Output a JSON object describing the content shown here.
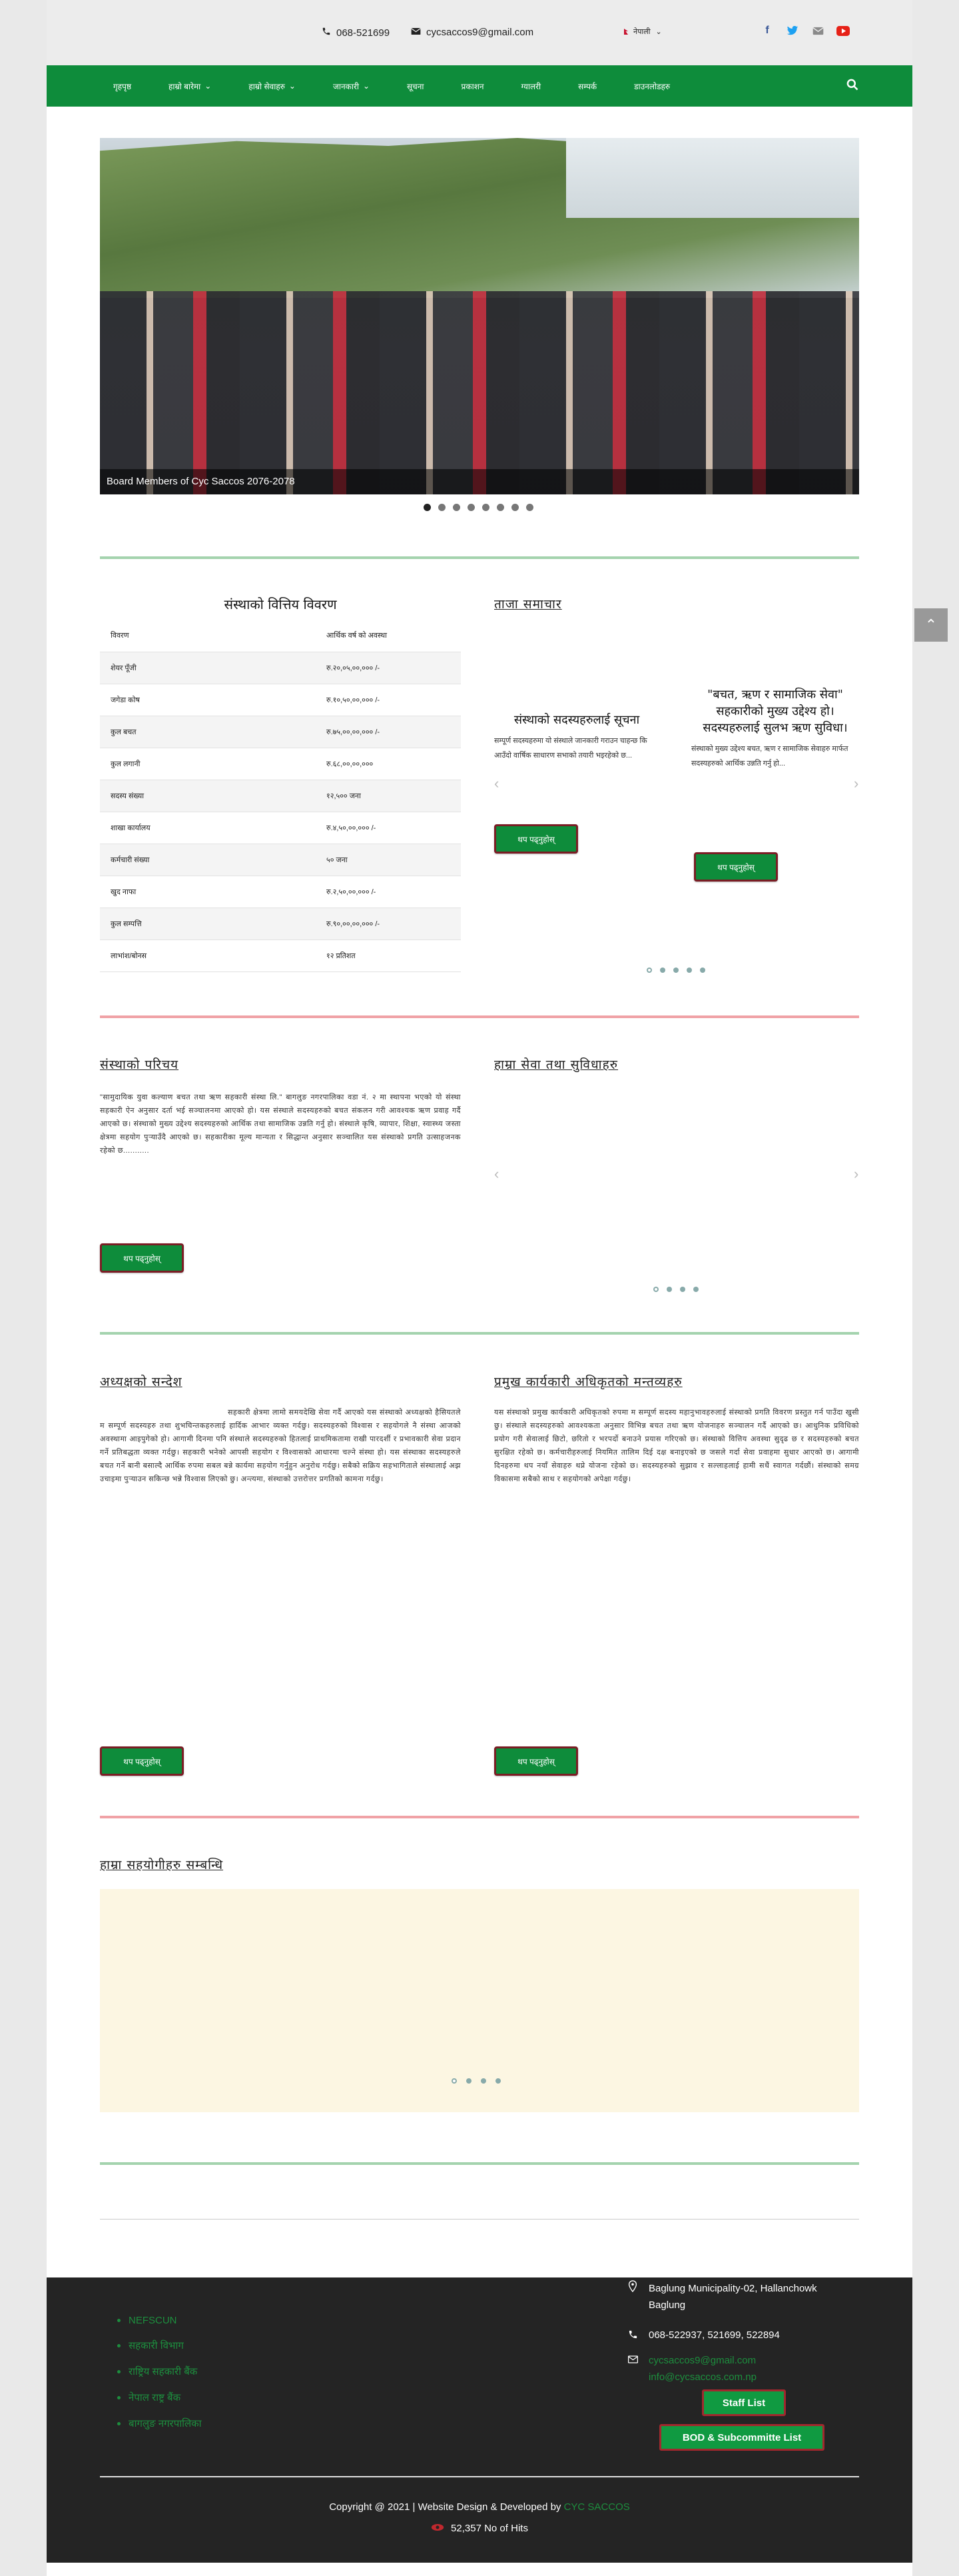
{
  "topbar": {
    "phone": "068-521699",
    "email": "cycsaccos9@gmail.com",
    "language": "नेपाली"
  },
  "nav": {
    "items": [
      "गृहपृष्ठ",
      "हाम्रो बारेमा",
      "हाम्रो सेवाहरु",
      "जानकारी",
      "सूचना",
      "प्रकाशन",
      "ग्यालरी",
      "सम्पर्क",
      "डाउनलोडहरु"
    ]
  },
  "hero": {
    "caption": "Board Members of Cyc Saccos 2076-2078",
    "slide_count": 8,
    "active_slide": 1
  },
  "capital": {
    "heading": "संस्थाको वित्तिय विवरण",
    "rows": [
      {
        "label": "विवरण",
        "value": "आर्थिक वर्ष को अवस्था"
      },
      {
        "label": "शेयर पूँजी",
        "value": "रु.२०,०५,००,००० /-"
      },
      {
        "label": "जगेडा कोष",
        "value": "रु.१०,५०,००,००० /-"
      },
      {
        "label": "कुल बचत",
        "value": "रु.७५,००,००,००० /-"
      },
      {
        "label": "कुल लगानी",
        "value": "रु.६८,००,००,०००"
      },
      {
        "label": "सदस्य संख्या",
        "value": "१२,५०० जना"
      },
      {
        "label": "शाखा कार्यालय",
        "value": "रु.४,५०,००,००० /-"
      },
      {
        "label": "कर्मचारी संख्या",
        "value": "५० जना"
      },
      {
        "label": "खुद नाफा",
        "value": "रु.२,५०,००,००० /-"
      },
      {
        "label": "कुल सम्पत्ति",
        "value": "रु.९०,००,००,००० /-"
      },
      {
        "label": "लाभांश/बोनस",
        "value": "१२ प्रतिशत"
      }
    ]
  },
  "news": {
    "heading": "ताजा समाचार",
    "cards": [
      {
        "title": "संस्थाको सदस्यहरुलाई सूचना",
        "desc": "सम्पूर्ण सदस्यहरुमा यो संस्थाले जानकारी गराउन चाहन्छ कि आउँदो वार्षिक साधारण सभाको तयारी भइरहेको छ...",
        "button": "थप पढ्नुहोस्"
      },
      {
        "title": "\"बचत, ऋण र सामाजिक सेवा\" सहकारीको मुख्य उद्देश्य हो। सदस्यहरुलाई सुलभ ऋण सुविधा।",
        "desc": "संस्थाको मुख्य उद्देश्य बचत, ऋण र सामाजिक सेवाहरु मार्फत सदस्यहरुको आर्थिक उन्नति गर्नु हो...",
        "button": "थप पढ्नुहोस्"
      }
    ]
  },
  "about": {
    "heading": "संस्थाको परिचय",
    "text": "\"सामुदायिक युवा कल्याण बचत तथा ऋण सहकारी संस्था लि.\" बागलुङ नगरपालिका वडा नं. २ मा स्थापना भएको यो संस्था सहकारी ऐन अनुसार दर्ता भई सञ्चालनमा आएको हो। यस संस्थाले सदस्यहरुको बचत संकलन गरी आवश्यक ऋण प्रवाह गर्दै आएको छ। संस्थाको मुख्य उद्देश्य सदस्यहरुको आर्थिक तथा सामाजिक उन्नति गर्नु हो। संस्थाले कृषि, व्यापार, शिक्षा, स्वास्थ्य जस्ता क्षेत्रमा सहयोग पुर्‍याउँदै आएको छ। सहकारीका मूल्य मान्यता र सिद्धान्त अनुसार सञ्चालित यस संस्थाको प्रगति उत्साहजनक रहेको छ...........",
    "button": "थप पढ्नुहोस्"
  },
  "services": {
    "heading": "हाम्रा सेवा तथा सुविधाहरु"
  },
  "chairman": {
    "heading": "अध्यक्षको सन्देश",
    "text": "सहकारी क्षेत्रमा लामो समयदेखि सेवा गर्दै आएको यस संस्थाको अध्यक्षको हैसियतले म सम्पूर्ण सदस्यहरु तथा शुभचिन्तकहरुलाई हार्दिक आभार व्यक्त गर्दछु। सदस्यहरुको विश्वास र सहयोगले नै संस्था आजको अवस्थामा आइपुगेको हो। आगामी दिनमा पनि संस्थाले सदस्यहरुको हितलाई प्राथमिकतामा राखी पारदर्शी र प्रभावकारी सेवा प्रदान गर्ने प्रतिबद्धता व्यक्त गर्दछु। सहकारी भनेको आपसी सहयोग र विश्वासको आधारमा चल्ने संस्था हो। यस संस्थाका सदस्यहरुले बचत गर्ने बानी बसाल्दै आर्थिक रुपमा सबल बन्ने कार्यमा सहयोग गर्नुहुन अनुरोध गर्दछु। सबैको सक्रिय सहभागिताले संस्थालाई अझ उचाइमा पुर्‍याउन सकिन्छ भन्ने विश्वास लिएको छु। अन्त्यमा, संस्थाको उत्तरोत्तर प्रगतिको कामना गर्दछु।",
    "button": "थप पढ्नुहोस्"
  },
  "manager": {
    "heading": "प्रमुख कार्यकारी अधिकृतको मन्तव्यहरु",
    "text": "यस संस्थाको प्रमुख कार्यकारी अधिकृतको रुपमा म सम्पूर्ण सदस्य महानुभावहरुलाई संस्थाको प्रगति विवरण प्रस्तुत गर्न पाउँदा खुसी छु। संस्थाले सदस्यहरुको आवश्यकता अनुसार विभिन्न बचत तथा ऋण योजनाहरु सञ्चालन गर्दै आएको छ। आधुनिक प्रविधिको प्रयोग गरी सेवालाई छिटो, छरितो र भरपर्दो बनाउने प्रयास गरिएको छ। संस्थाको वित्तिय अवस्था सुदृढ छ र सदस्यहरुको बचत सुरक्षित रहेको छ। कर्मचारीहरुलाई नियमित तालिम दिई दक्ष बनाइएको छ जसले गर्दा सेवा प्रवाहमा सुधार आएको छ। आगामी दिनहरुमा थप नयाँ सेवाहरु थप्ने योजना रहेको छ। सदस्यहरुको सुझाव र सल्लाहलाई हामी सधैं स्वागत गर्दछौं। संस्थाको समग्र विकासमा सबैको साथ र सहयोगको अपेक्षा गर्दछु।",
    "button": "थप पढ्नुहोस्"
  },
  "notice": {
    "heading": "हाम्रा सहयोगीहरु सम्बन्धि"
  },
  "footer": {
    "links": [
      "NEFSCUN",
      "सहकारी विभाग",
      "राष्ट्रिय सहकारी बैंक",
      "नेपाल राष्ट्र बैंक",
      "बागलुङ नगरपालिका"
    ],
    "address_line1": "Baglung Municipality-02, Hallanchowk",
    "address_line2": "Baglung",
    "phones": "068-522937, 521699, 522894",
    "email1": "cycsaccos9@gmail.com",
    "email2": "info@cycsaccos.com.np",
    "staff_button": "Staff List",
    "bod_button": "BOD & Subcommitte List",
    "copyright_prefix": "Copyright @ 2021 | Website Design & Developed by",
    "copyright_link": "CYC SACCOS",
    "hits": "52,357 No of Hits"
  },
  "colors": {
    "nav_green": "#0e8c3b",
    "footer_bg": "#242424",
    "link_green": "#1d8e3e",
    "rule_green": "#a4d3ae",
    "rule_red": "#f0a2a6"
  }
}
